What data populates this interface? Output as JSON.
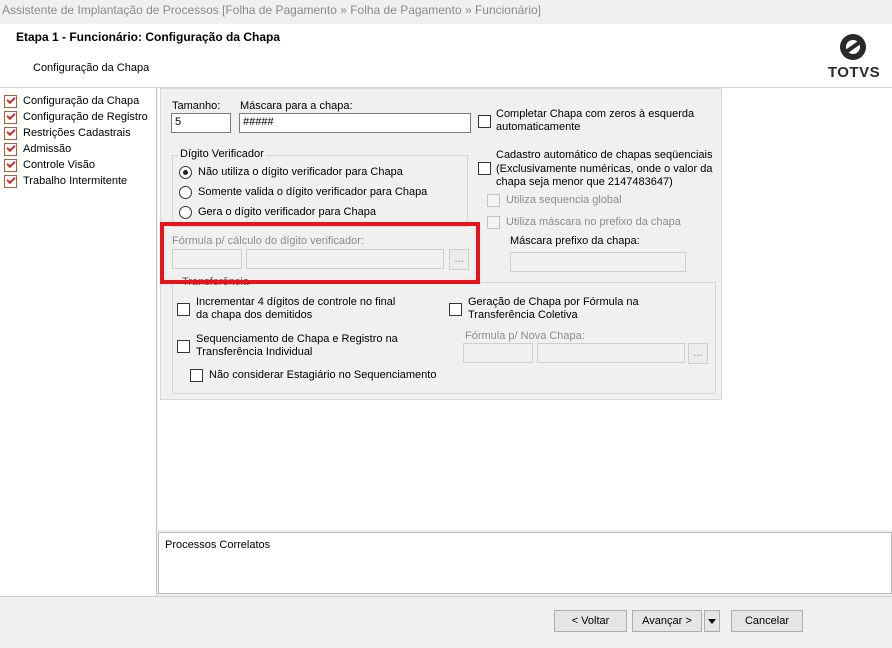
{
  "window_title": "Assistente de Implantação de Processos [Folha de Pagamento » Folha de Pagamento » Funcionário]",
  "header": {
    "step_title": "Etapa 1 - Funcionário: Configuração da Chapa",
    "step_subtitle": "Configuração da Chapa",
    "logo_text": "TOTVS"
  },
  "sidebar": {
    "items": [
      {
        "label": "Configuração da Chapa",
        "icon": "checklist-icon"
      },
      {
        "label": "Configuração de Registro",
        "icon": "checklist-icon"
      },
      {
        "label": "Restrições Cadastrais",
        "icon": "checklist-icon"
      },
      {
        "label": "Admissão",
        "icon": "checklist-icon"
      },
      {
        "label": "Controle Visão",
        "icon": "checklist-icon"
      },
      {
        "label": "Trabalho Intermitente",
        "icon": "checklist-icon"
      }
    ]
  },
  "form": {
    "tamanho": {
      "label": "Tamanho:",
      "value": "5"
    },
    "mascara": {
      "label": "Máscara para a chapa:",
      "value": "#####"
    },
    "completar_zeros": {
      "label_line1": "Completar Chapa com zeros à esquerda",
      "label_line2": "automaticamente",
      "checked": false
    },
    "digito": {
      "legend": "Dígito Verificador",
      "options": [
        {
          "label": "Não utiliza o dígito verificador para Chapa",
          "selected": true
        },
        {
          "label": "Somente valida o dígito verificador para Chapa",
          "selected": false
        },
        {
          "label": "Gera o dígito verificador para Chapa",
          "selected": false
        }
      ]
    },
    "formula_digito": {
      "label": "Fórmula p/ cálculo do dígito verificador:",
      "code": "",
      "desc": "",
      "ellipsis": "..."
    },
    "cadastro_auto": {
      "line1": "Cadastro automático de chapas seqüenciais",
      "line2": "(Exclusivamente numéricas, onde o valor da",
      "line3": "chapa seja menor que 2147483647)",
      "checked": false
    },
    "seq_global": {
      "label": "Utiliza sequencia global",
      "checked": false
    },
    "mascara_prefixo_chk": {
      "label": "Utiliza máscara no prefixo da chapa",
      "checked": false
    },
    "mascara_prefixo": {
      "label": "Máscara prefixo da chapa:",
      "value": ""
    },
    "transferencia": {
      "legend": "Transferência",
      "incrementar": {
        "line1": "Incrementar 4 dígitos de controle no final",
        "line2": "da chapa dos demitidos",
        "checked": false
      },
      "sequenciamento": {
        "line1": "Sequenciamento de Chapa e Registro na",
        "line2": "Transferência Individual",
        "checked": false
      },
      "estagiario": {
        "label": "Não considerar Estagiário no Sequenciamento",
        "checked": false
      },
      "geracao": {
        "line1": "Geração de Chapa por Fórmula na",
        "line2": "Transferência Coletiva",
        "checked": false
      },
      "formula_nova": {
        "label": "Fórmula p/ Nova Chapa:",
        "code": "",
        "desc": "",
        "ellipsis": "..."
      }
    }
  },
  "correlatos": {
    "title": "Processos Correlatos"
  },
  "footer": {
    "voltar": "< Voltar",
    "avancar": "Avançar >",
    "cancelar": "Cancelar"
  },
  "colors": {
    "highlight": "#e8141c",
    "accent": "#2a2a2a"
  }
}
